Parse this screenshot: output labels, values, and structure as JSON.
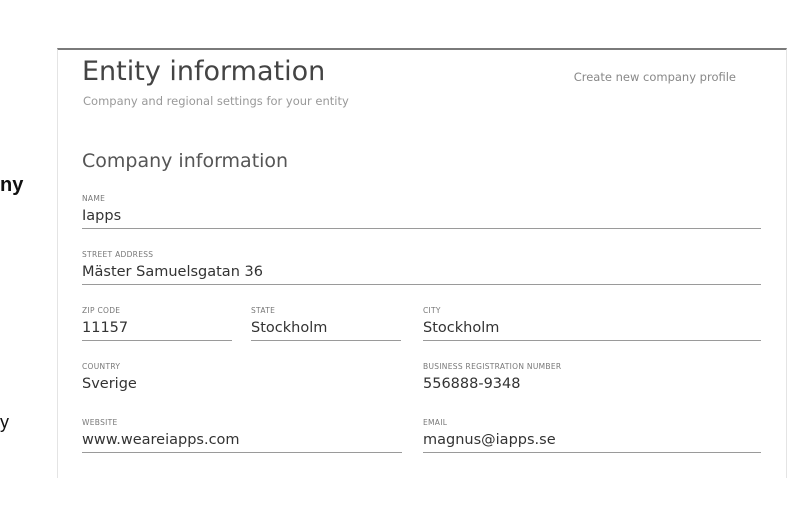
{
  "side": {
    "text_top": "ny",
    "text_bottom": "y"
  },
  "entity": {
    "title": "Entity information",
    "subtitle": "Company and regional settings for your entity",
    "create_link": "Create new company profile"
  },
  "company": {
    "section_title": "Company information",
    "fields": {
      "name": {
        "label": "NAME",
        "value": "Iapps"
      },
      "street": {
        "label": "STREET ADDRESS",
        "value": "Mäster Samuelsgatan 36"
      },
      "zip": {
        "label": "ZIP CODE",
        "value": "11157"
      },
      "state": {
        "label": "STATE",
        "value": "Stockholm"
      },
      "city": {
        "label": "CITY",
        "value": "Stockholm"
      },
      "country": {
        "label": "COUNTRY",
        "value": "Sverige"
      },
      "brn": {
        "label": "BUSINESS REGISTRATION NUMBER",
        "value": "556888-9348"
      },
      "website": {
        "label": "WEBSITE",
        "value": "www.weareiapps.com"
      },
      "email": {
        "label": "EMAIL",
        "value": "magnus@iapps.se"
      }
    }
  }
}
